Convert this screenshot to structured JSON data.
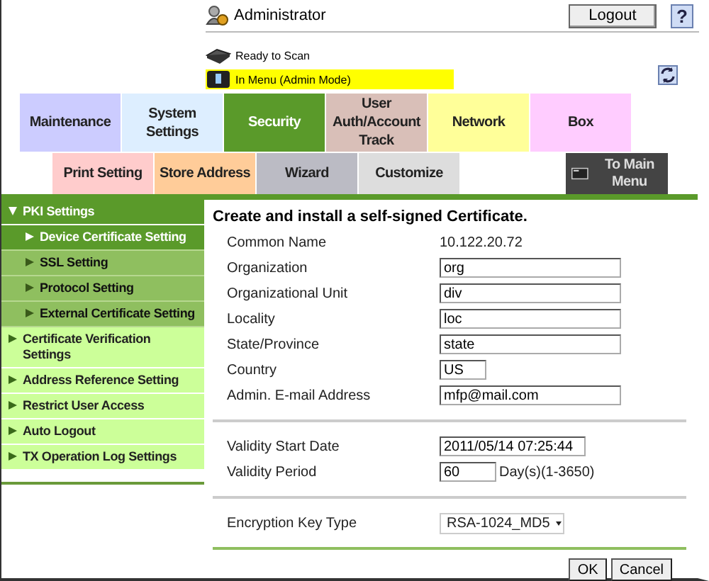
{
  "header": {
    "user": "Administrator",
    "logout": "Logout",
    "help": "?",
    "status": [
      {
        "text": "Ready to Scan",
        "highlighted": false
      },
      {
        "text": "In Menu (Admin Mode)",
        "highlighted": true
      }
    ]
  },
  "tabs": [
    {
      "label": "Maintenance",
      "color": "#ccccff",
      "selected": false
    },
    {
      "label": "System Settings",
      "color": "#ddeeff",
      "selected": false
    },
    {
      "label": "Security",
      "color": "#5a9a2a",
      "selected": true
    },
    {
      "label": "User Auth/Account Track",
      "color": "#d9bfb8",
      "selected": false
    },
    {
      "label": "Network",
      "color": "#ffff99",
      "selected": false
    },
    {
      "label": "Box",
      "color": "#ffccff",
      "selected": false
    }
  ],
  "subtabs": [
    {
      "label": "Print Setting",
      "color": "#ffcccc",
      "selected": false
    },
    {
      "label": "Store Address",
      "color": "#ffcc99",
      "selected": false
    },
    {
      "label": "Wizard",
      "color": "#bbbbc4",
      "selected": false
    },
    {
      "label": "Customize",
      "color": "#dddddd",
      "selected": false
    }
  ],
  "main_menu_button": "To Main Menu",
  "sidebar": {
    "items": [
      {
        "label": "PKI Settings",
        "expanded": true,
        "children": [
          {
            "label": "Device Certificate Setting",
            "selected": true
          },
          {
            "label": "SSL Setting",
            "selected": false
          },
          {
            "label": "Protocol Setting",
            "selected": false
          },
          {
            "label": "External Certificate Setting",
            "selected": false
          }
        ]
      },
      {
        "label": "Certificate Verification Settings",
        "expanded": false
      },
      {
        "label": "Address Reference Setting",
        "expanded": false
      },
      {
        "label": "Restrict User Access",
        "expanded": false
      },
      {
        "label": "Auto Logout",
        "expanded": false
      },
      {
        "label": "TX Operation Log Settings",
        "expanded": false
      }
    ]
  },
  "form": {
    "heading": "Create and install a self-signed Certificate.",
    "sections": [
      [
        {
          "kind": "text",
          "label": "Common Name",
          "value": "10.122.20.72"
        },
        {
          "kind": "field",
          "label": "Organization",
          "value": "org"
        },
        {
          "kind": "field",
          "label": "Organizational Unit",
          "value": "div"
        },
        {
          "kind": "field",
          "label": "Locality",
          "value": "loc"
        },
        {
          "kind": "field",
          "label": "State/Province",
          "value": "state"
        },
        {
          "kind": "tiny",
          "label": "Country",
          "value": "US"
        },
        {
          "kind": "field",
          "label": "Admin. E-mail Address",
          "value": "mfp@mail.com"
        }
      ],
      [
        {
          "kind": "medium",
          "label": "Validity Start Date",
          "value": "2011/05/14 07:25:44"
        },
        {
          "kind": "short",
          "label": "Validity Period",
          "value": "60",
          "unit": "Day(s)(1-3650)"
        }
      ],
      [
        {
          "kind": "select",
          "label": "Encryption Key Type",
          "value": "RSA-1024_MD5"
        }
      ]
    ],
    "buttons": [
      "OK",
      "Cancel"
    ]
  }
}
